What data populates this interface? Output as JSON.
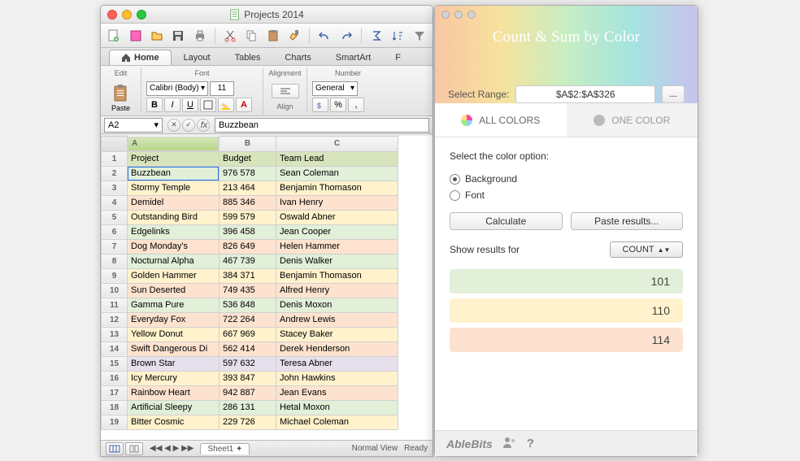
{
  "window": {
    "title": "Projects 2014"
  },
  "ribbon": {
    "tabs": [
      "Home",
      "Layout",
      "Tables",
      "Charts",
      "SmartArt",
      "F"
    ],
    "groups": {
      "edit": "Edit",
      "font": "Font",
      "alignment": "Alignment",
      "number": "Number"
    },
    "paste": "Paste",
    "font_name": "Calibri (Body)",
    "font_size": "11",
    "bold": "B",
    "italic": "I",
    "underline": "U",
    "align": "Align",
    "number_format": "General"
  },
  "namebox": {
    "cell": "A2",
    "formula": "Buzzbean"
  },
  "cols": [
    "A",
    "B",
    "C"
  ],
  "headers": {
    "a": "Project",
    "b": "Budget",
    "c": "Team Lead"
  },
  "rows": [
    {
      "n": 2,
      "bg": "g",
      "a": "Buzzbean",
      "b": "976 578",
      "c": "Sean Coleman"
    },
    {
      "n": 3,
      "bg": "y",
      "a": "Stormy Temple",
      "b": "213 464",
      "c": "Benjamin Thomason"
    },
    {
      "n": 4,
      "bg": "o",
      "a": "Demidel",
      "b": "885 346",
      "c": "Ivan Henry"
    },
    {
      "n": 5,
      "bg": "y",
      "a": "Outstanding Bird",
      "b": "599 579",
      "c": "Oswald Abner"
    },
    {
      "n": 6,
      "bg": "g",
      "a": "Edgelinks",
      "b": "396 458",
      "c": "Jean Cooper"
    },
    {
      "n": 7,
      "bg": "o",
      "a": "Dog Monday's",
      "b": "826 649",
      "c": "Helen Hammer"
    },
    {
      "n": 8,
      "bg": "g",
      "a": "Nocturnal Alpha",
      "b": "467 739",
      "c": "Denis Walker"
    },
    {
      "n": 9,
      "bg": "y",
      "a": "Golden Hammer",
      "b": "384 371",
      "c": "Benjamin Thomason"
    },
    {
      "n": 10,
      "bg": "o",
      "a": "Sun Deserted",
      "b": "749 435",
      "c": "Alfred Henry"
    },
    {
      "n": 11,
      "bg": "g",
      "a": "Gamma Pure",
      "b": "536 848",
      "c": "Denis Moxon"
    },
    {
      "n": 12,
      "bg": "o",
      "a": "Everyday Fox",
      "b": "722 264",
      "c": "Andrew Lewis"
    },
    {
      "n": 13,
      "bg": "y",
      "a": "Yellow Donut",
      "b": "667 969",
      "c": "Stacey Baker"
    },
    {
      "n": 14,
      "bg": "o",
      "a": "Swift Dangerous Di",
      "b": "562 414",
      "c": "Derek Henderson"
    },
    {
      "n": 15,
      "bg": "p",
      "a": "Brown Star",
      "b": "597 632",
      "c": "Teresa Abner"
    },
    {
      "n": 16,
      "bg": "y",
      "a": "Icy Mercury",
      "b": "393 847",
      "c": "John Hawkins"
    },
    {
      "n": 17,
      "bg": "o",
      "a": "Rainbow Heart",
      "b": "942 887",
      "c": "Jean Evans"
    },
    {
      "n": 18,
      "bg": "g",
      "a": "Artificial Sleepy",
      "b": "286 131",
      "c": "Hetal Moxon"
    },
    {
      "n": 19,
      "bg": "y",
      "a": "Bitter Cosmic",
      "b": "229 726",
      "c": "Michael Coleman"
    }
  ],
  "status": {
    "view": "Normal View",
    "ready": "Ready",
    "sheet": "Sheet1"
  },
  "panel": {
    "title": "Count & Sum by Color",
    "select_range_label": "Select Range:",
    "range": "$A$2:$A$326",
    "range_btn": "...",
    "tab_all": "ALL COLORS",
    "tab_one": "ONE COLOR",
    "option_label": "Select the color option:",
    "opt_bg": "Background",
    "opt_font": "Font",
    "btn_calc": "Calculate",
    "btn_paste": "Paste results...",
    "show_label": "Show results for",
    "dropdown": "COUNT",
    "results": [
      {
        "bg": "g",
        "v": "101"
      },
      {
        "bg": "y",
        "v": "110"
      },
      {
        "bg": "o",
        "v": "114"
      }
    ],
    "brand": "AbleBits",
    "help": "?"
  }
}
